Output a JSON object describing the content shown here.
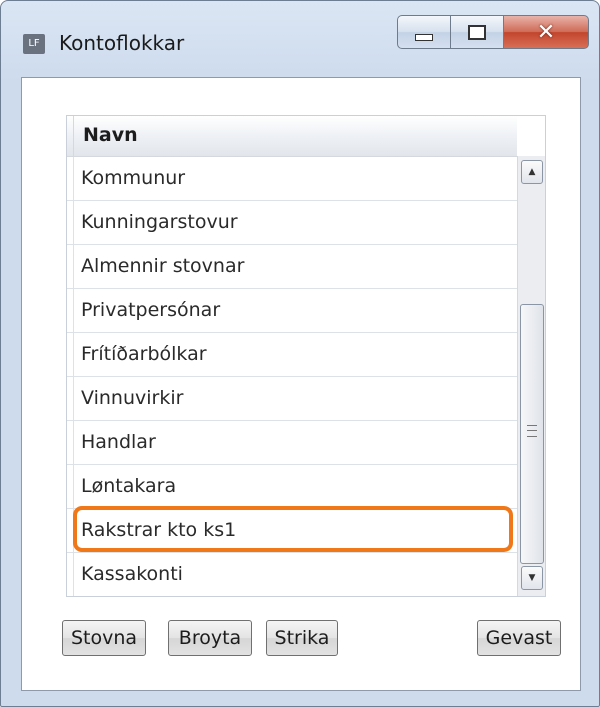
{
  "window": {
    "icon_text": "LF",
    "title": "Kontoflokkar",
    "caption_icons": [
      "minimize-icon",
      "maximize-icon",
      "close-icon"
    ]
  },
  "list": {
    "column_header": "Navn",
    "rows": [
      "Kommunur",
      "Kunningarstovur",
      "Almennir stovnar",
      "Privatpersónar",
      "Frítíðarbólkar",
      "Vinnuvirkir",
      "Handlar",
      "Løntakara",
      "Rakstrar kto ks1",
      "Kassakonti"
    ],
    "highlighted_row": "Rakstrar kto ks1",
    "highlight_color": "#f07818"
  },
  "buttons": {
    "create": "Stovna",
    "edit": "Broyta",
    "delete": "Strika",
    "save": "Gevast"
  }
}
